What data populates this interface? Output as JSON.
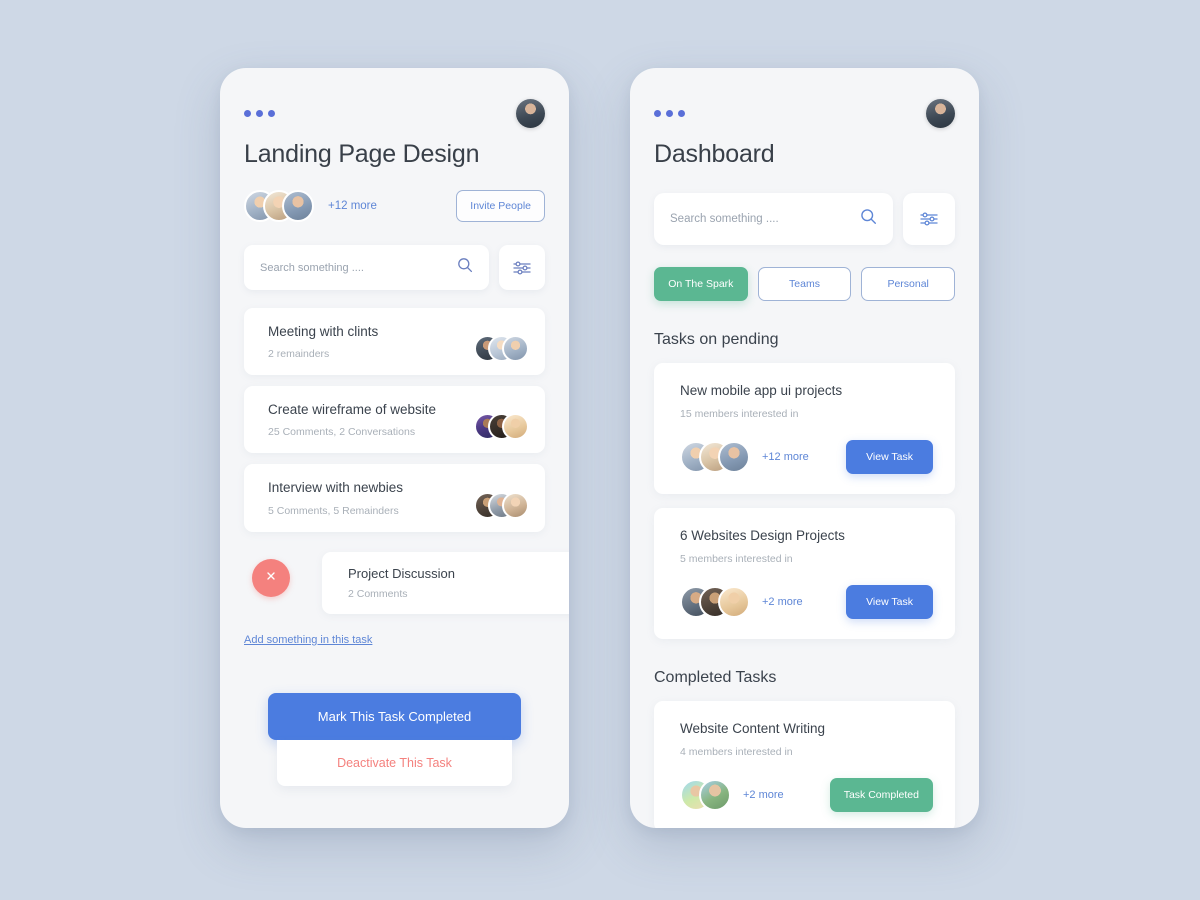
{
  "theme": {
    "background": "#ced8e6",
    "phone_bg": "#f5f6f8",
    "accent_blue": "#4b7ce0",
    "link_blue": "#5e86d6",
    "accent_green": "#5bb792",
    "accent_red": "#f4817e",
    "dots_purple": "#5a6fd8",
    "text_dark": "#3b434d",
    "text_muted": "#a9b0b8"
  },
  "left_phone": {
    "menu_icon": "more-dots-icon",
    "profile_avatar": "user-avatar",
    "title": "Landing Page Design",
    "members": {
      "more_label": "+12 more",
      "invite_label": "Invite People",
      "avatars": [
        "member-1",
        "member-2",
        "member-3"
      ]
    },
    "search": {
      "placeholder": "Search something ....",
      "value": "",
      "search_icon": "search-icon",
      "filter_icon": "filter-sliders-icon"
    },
    "tasks": [
      {
        "title": "Meeting with clints",
        "subtitle": "2 remainders",
        "avatars": [
          "member-4",
          "member-5",
          "member-6"
        ]
      },
      {
        "title": "Create wireframe of website",
        "subtitle": "25 Comments, 2 Conversations",
        "avatars": [
          "member-7",
          "member-8",
          "member-9"
        ]
      },
      {
        "title": "Interview with newbies",
        "subtitle": "5 Comments, 5 Remainders",
        "avatars": [
          "member-10",
          "member-11",
          "member-12"
        ]
      }
    ],
    "swiped_task": {
      "title": "Project Discussion",
      "subtitle": "2 Comments",
      "delete_icon": "close-icon",
      "avatars": [
        "member-13"
      ]
    },
    "add_link": "Add something in this task",
    "actions": {
      "primary": "Mark This Task Completed",
      "danger": "Deactivate This Task"
    }
  },
  "right_phone": {
    "menu_icon": "more-dots-icon",
    "profile_avatar": "user-avatar",
    "title": "Dashboard",
    "search": {
      "placeholder": "Search something ....",
      "value": "",
      "search_icon": "search-icon",
      "filter_icon": "filter-sliders-icon"
    },
    "tabs": [
      {
        "label": "On The Spark",
        "active": true
      },
      {
        "label": "Teams",
        "active": false
      },
      {
        "label": "Personal",
        "active": false
      }
    ],
    "sections": [
      {
        "title": "Tasks on pending",
        "cards": [
          {
            "title": "New mobile app ui projects",
            "subtitle": "15 members interested in",
            "more_label": "+12 more",
            "action_label": "View Task",
            "action_style": "primary",
            "avatars": [
              "member-1",
              "member-2",
              "member-3"
            ]
          },
          {
            "title": "6 Websites Design Projects",
            "subtitle": "5 members interested in",
            "more_label": "+2 more",
            "action_label": "View Task",
            "action_style": "primary",
            "avatars": [
              "member-14",
              "member-15",
              "member-16"
            ]
          }
        ]
      },
      {
        "title": "Completed Tasks",
        "cards": [
          {
            "title": "Website Content Writing",
            "subtitle": "4 members interested in",
            "more_label": "+2 more",
            "action_label": "Task Completed",
            "action_style": "completed",
            "avatars": [
              "member-17",
              "member-18"
            ]
          }
        ]
      }
    ]
  }
}
